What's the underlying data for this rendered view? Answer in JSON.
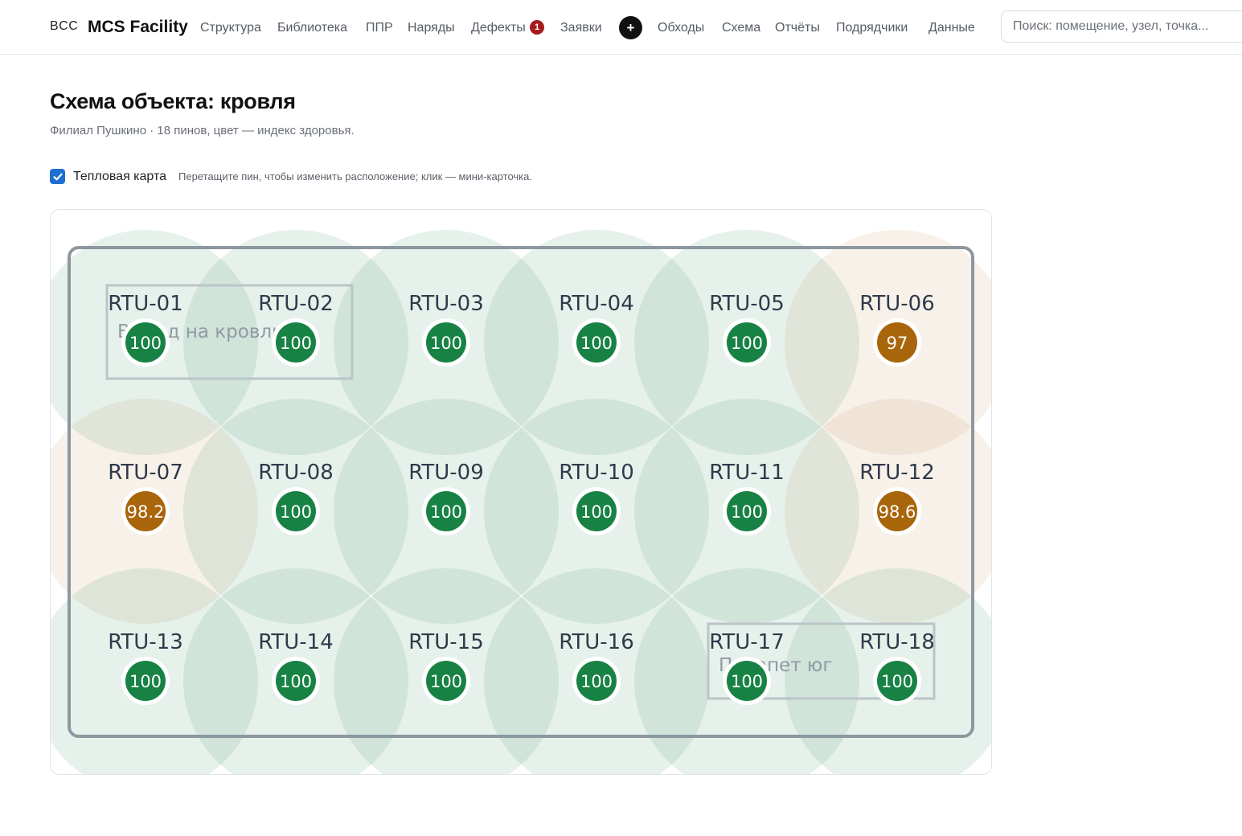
{
  "header": {
    "brand_small": "BCC",
    "brand_main": "MCS Facility",
    "nav": [
      {
        "label": "Структура"
      },
      {
        "label": "Библиотека"
      },
      {
        "label": "ППР"
      },
      {
        "label": "Наряды"
      },
      {
        "label": "Дефекты",
        "badge": "1"
      },
      {
        "label": "Заявки"
      },
      {
        "label": "Обходы"
      },
      {
        "label": "Схема"
      },
      {
        "label": "Отчёты"
      },
      {
        "label": "Подрядчики"
      },
      {
        "label": "Данные"
      }
    ],
    "add_button": "+",
    "search_placeholder": "Поиск: помещение, узел, точка..."
  },
  "page": {
    "title": "Схема объекта: кровля",
    "subtitle": "Филиал Пушкино · 18 пинов, цвет — индекс здоровья."
  },
  "heatmap": {
    "label": "Тепловая карта",
    "checked": true,
    "hint": "Перетащите пин, чтобы изменить расположение; клик — мини-карточка."
  },
  "map": {
    "zones": [
      {
        "label": "Выход на кровлю"
      },
      {
        "label": "Парапет юг"
      }
    ],
    "colors": {
      "healthy": "#178244",
      "warning": "#a8650a",
      "heat_healthy": "#3f8f63",
      "heat_warning": "#c4915a",
      "roof_outline": "#8c979f"
    },
    "pins": [
      {
        "label": "RTU-01",
        "value": "100",
        "status": "healthy"
      },
      {
        "label": "RTU-02",
        "value": "100",
        "status": "healthy"
      },
      {
        "label": "RTU-03",
        "value": "100",
        "status": "healthy"
      },
      {
        "label": "RTU-04",
        "value": "100",
        "status": "healthy"
      },
      {
        "label": "RTU-05",
        "value": "100",
        "status": "healthy"
      },
      {
        "label": "RTU-06",
        "value": "97",
        "status": "warning"
      },
      {
        "label": "RTU-07",
        "value": "98.2",
        "status": "warning"
      },
      {
        "label": "RTU-08",
        "value": "100",
        "status": "healthy"
      },
      {
        "label": "RTU-09",
        "value": "100",
        "status": "healthy"
      },
      {
        "label": "RTU-10",
        "value": "100",
        "status": "healthy"
      },
      {
        "label": "RTU-11",
        "value": "100",
        "status": "healthy"
      },
      {
        "label": "RTU-12",
        "value": "98.6",
        "status": "warning"
      },
      {
        "label": "RTU-13",
        "value": "100",
        "status": "healthy"
      },
      {
        "label": "RTU-14",
        "value": "100",
        "status": "healthy"
      },
      {
        "label": "RTU-15",
        "value": "100",
        "status": "healthy"
      },
      {
        "label": "RTU-16",
        "value": "100",
        "status": "healthy"
      },
      {
        "label": "RTU-17",
        "value": "100",
        "status": "healthy"
      },
      {
        "label": "RTU-18",
        "value": "100",
        "status": "healthy"
      }
    ]
  }
}
